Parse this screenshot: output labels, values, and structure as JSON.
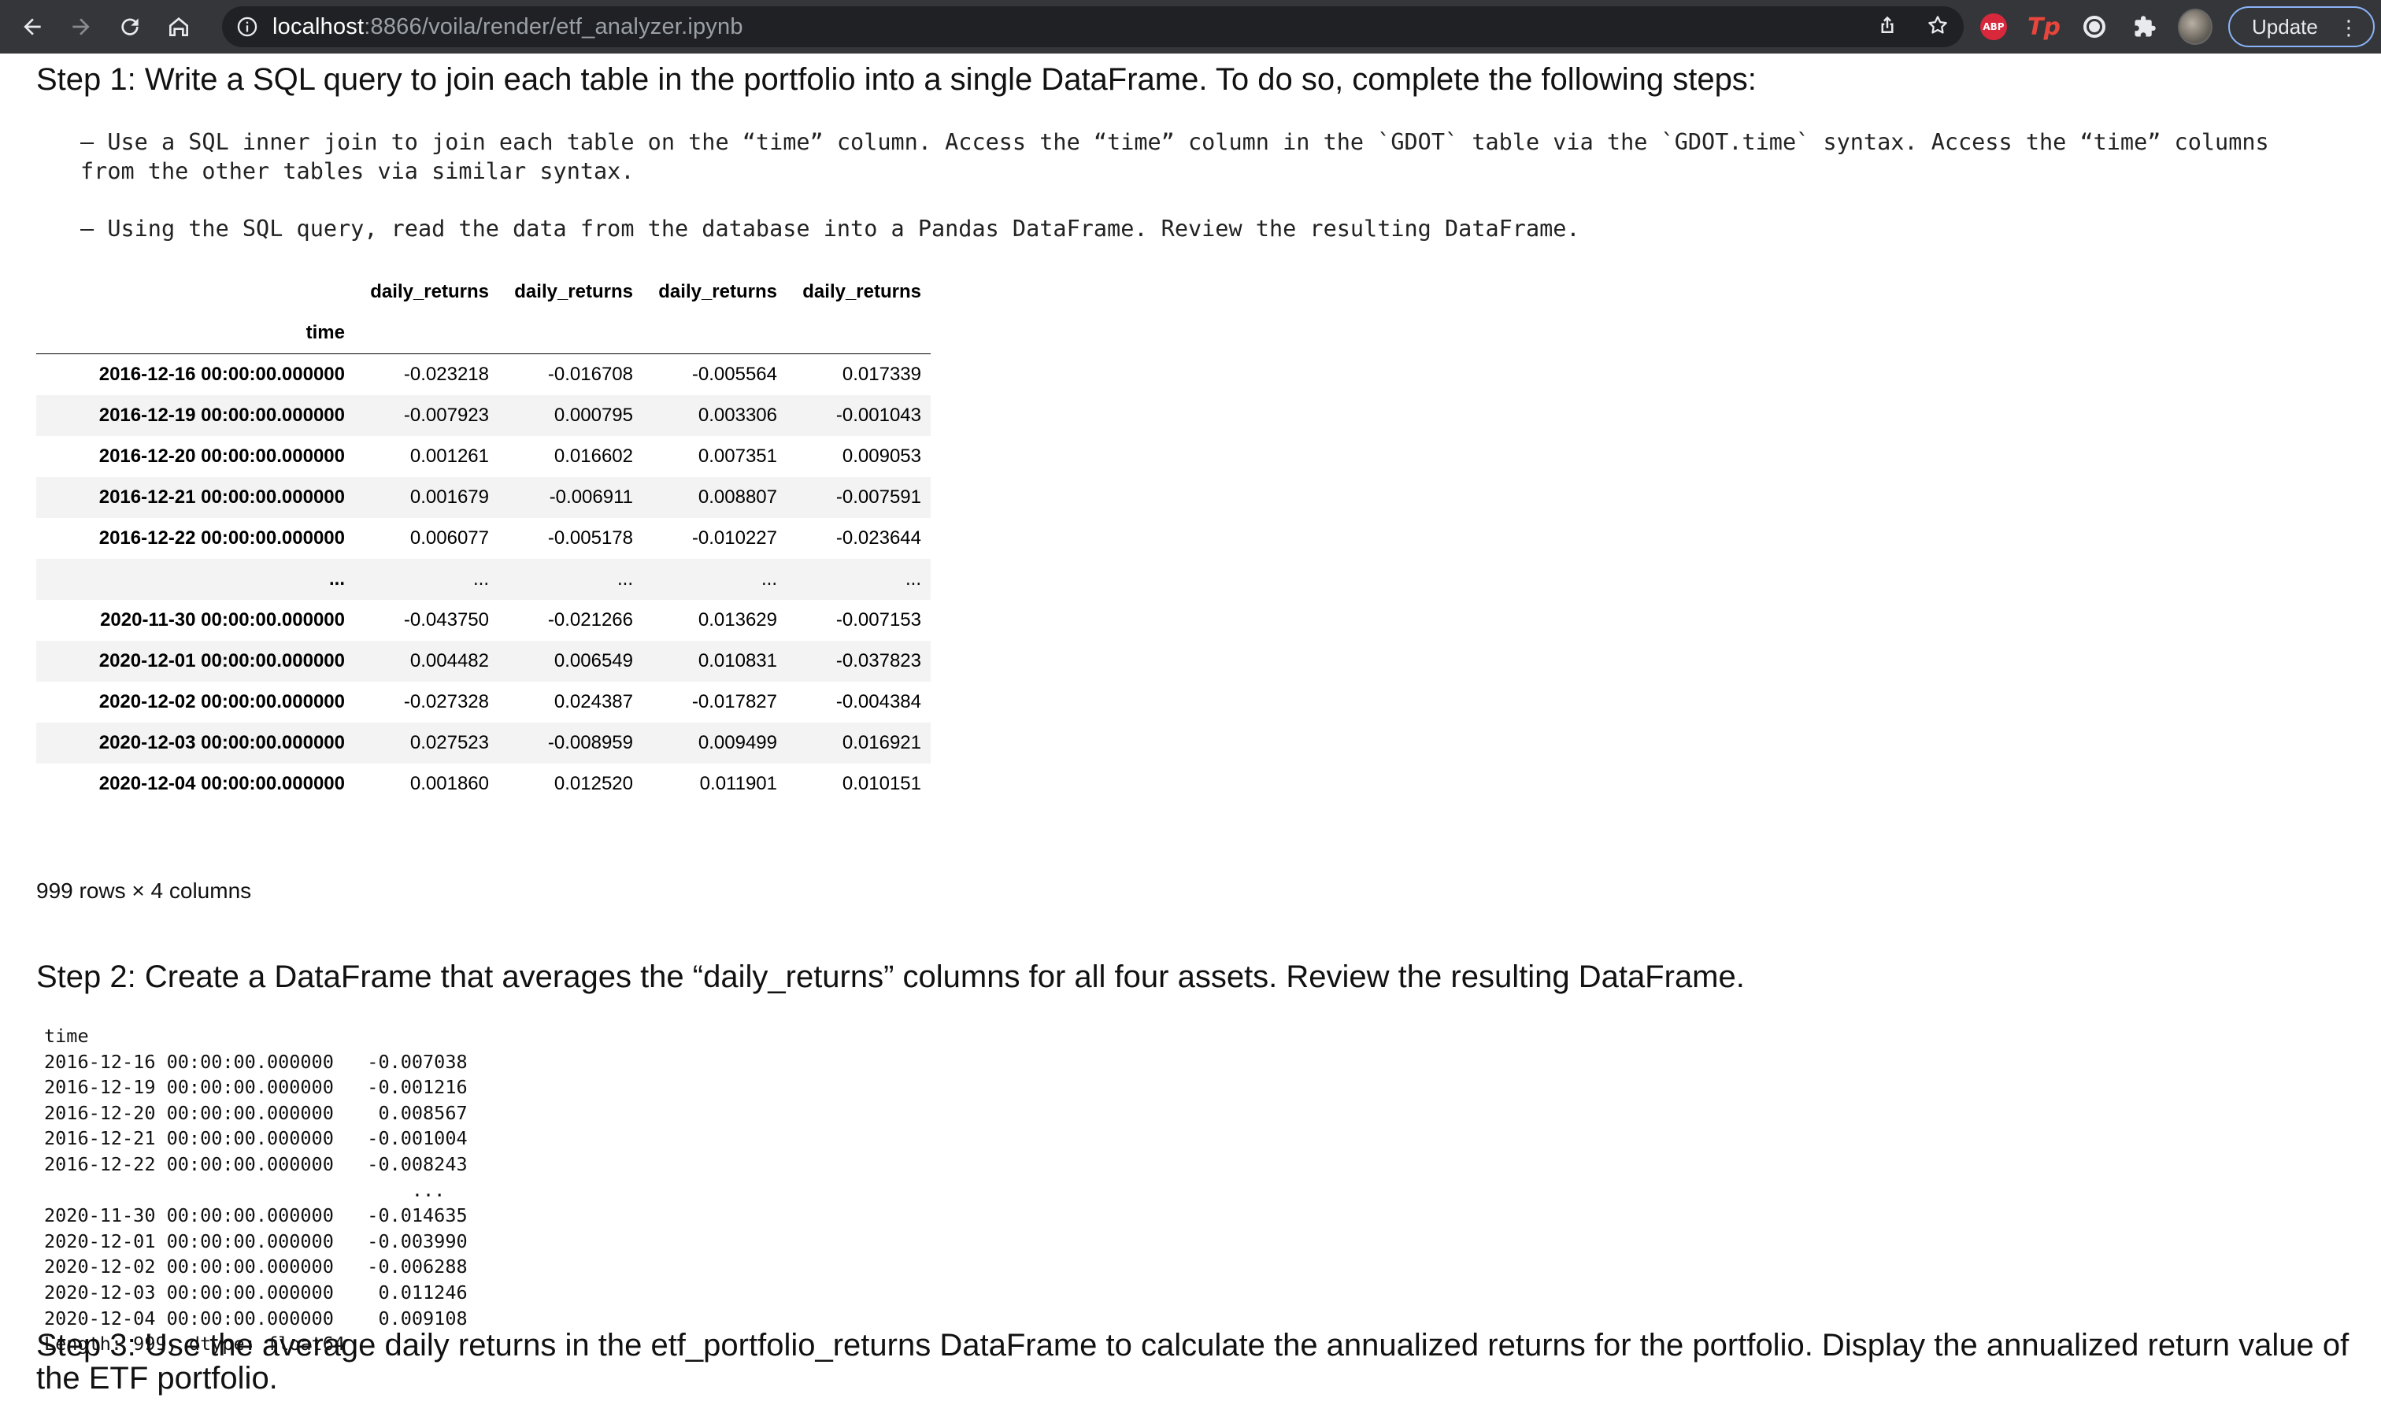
{
  "browser": {
    "url_host": "localhost",
    "url_rest": ":8866/voila/render/etf_analyzer.ipynb",
    "update_label": "Update",
    "abp_label": "ABP",
    "tp_label": "Tp"
  },
  "step1": {
    "heading": "Step 1: Write a SQL query to join each table in the portfolio into a single DataFrame. To do so, complete the following steps:",
    "bullet1": "– Use a SQL inner join to join each table on the “time” column. Access the “time” column in the `GDOT` table via the `GDOT.time` syntax. Access the “time” columns from the other tables via similar syntax.",
    "bullet2": "– Using the SQL query, read the data from the database into a Pandas DataFrame. Review the resulting DataFrame."
  },
  "dataframe": {
    "columns": [
      "daily_returns",
      "daily_returns",
      "daily_returns",
      "daily_returns"
    ],
    "index_name": "time",
    "rows": [
      {
        "idx": "2016-12-16 00:00:00.000000",
        "v": [
          "-0.023218",
          "-0.016708",
          "-0.005564",
          "0.017339"
        ]
      },
      {
        "idx": "2016-12-19 00:00:00.000000",
        "v": [
          "-0.007923",
          "0.000795",
          "0.003306",
          "-0.001043"
        ]
      },
      {
        "idx": "2016-12-20 00:00:00.000000",
        "v": [
          "0.001261",
          "0.016602",
          "0.007351",
          "0.009053"
        ]
      },
      {
        "idx": "2016-12-21 00:00:00.000000",
        "v": [
          "0.001679",
          "-0.006911",
          "0.008807",
          "-0.007591"
        ]
      },
      {
        "idx": "2016-12-22 00:00:00.000000",
        "v": [
          "0.006077",
          "-0.005178",
          "-0.010227",
          "-0.023644"
        ]
      },
      {
        "idx": "...",
        "v": [
          "...",
          "...",
          "...",
          "..."
        ]
      },
      {
        "idx": "2020-11-30 00:00:00.000000",
        "v": [
          "-0.043750",
          "-0.021266",
          "0.013629",
          "-0.007153"
        ]
      },
      {
        "idx": "2020-12-01 00:00:00.000000",
        "v": [
          "0.004482",
          "0.006549",
          "0.010831",
          "-0.037823"
        ]
      },
      {
        "idx": "2020-12-02 00:00:00.000000",
        "v": [
          "-0.027328",
          "0.024387",
          "-0.017827",
          "-0.004384"
        ]
      },
      {
        "idx": "2020-12-03 00:00:00.000000",
        "v": [
          "0.027523",
          "-0.008959",
          "0.009499",
          "0.016921"
        ]
      },
      {
        "idx": "2020-12-04 00:00:00.000000",
        "v": [
          "0.001860",
          "0.012520",
          "0.011901",
          "0.010151"
        ]
      }
    ],
    "shape_text": "999 rows × 4 columns"
  },
  "step2": {
    "heading": "Step 2: Create a DataFrame that averages the “daily_returns” columns for all four assets. Review the resulting DataFrame.",
    "series_output": "time\n2016-12-16 00:00:00.000000   -0.007038\n2016-12-19 00:00:00.000000   -0.001216\n2016-12-20 00:00:00.000000    0.008567\n2016-12-21 00:00:00.000000   -0.001004\n2016-12-22 00:00:00.000000   -0.008243\n                                 ...\n2020-11-30 00:00:00.000000   -0.014635\n2020-12-01 00:00:00.000000   -0.003990\n2020-12-02 00:00:00.000000   -0.006288\n2020-12-03 00:00:00.000000    0.011246\n2020-12-04 00:00:00.000000    0.009108\nLength: 999, dtype: float64"
  },
  "step3": {
    "heading": "Step 3: Use the average daily returns in the etf_portfolio_returns DataFrame to calculate the annualized returns for the portfolio. Display the annualized return value of the ETF portfolio."
  }
}
